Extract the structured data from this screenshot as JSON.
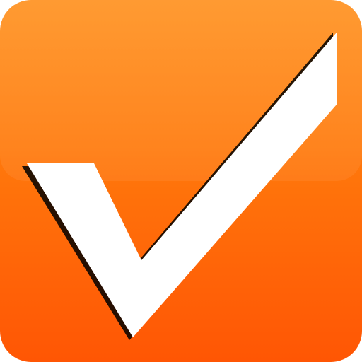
{
  "icon": {
    "name": "checkmark-icon",
    "background_top": "#ff8a10",
    "background_bottom": "#ff5604",
    "mark_color": "#ffffff",
    "mark_shadow": "#000000"
  }
}
